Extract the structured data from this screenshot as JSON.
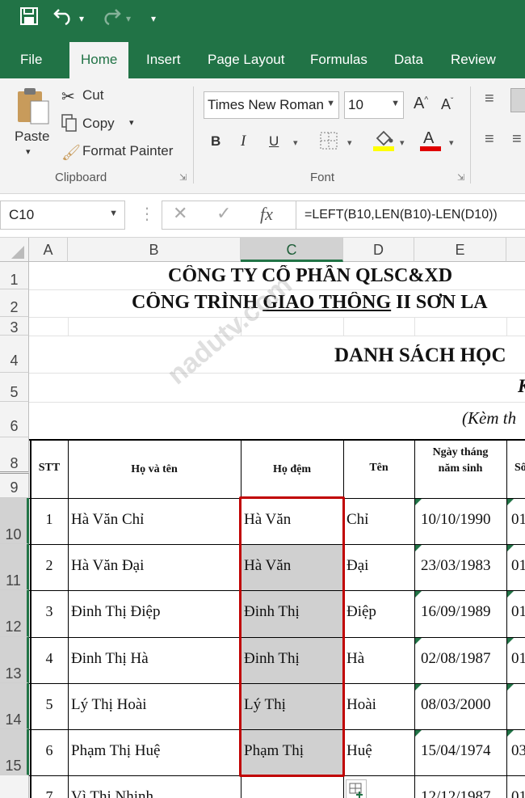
{
  "ribbon_tabs": [
    "File",
    "Home",
    "Insert",
    "Page Layout",
    "Formulas",
    "Data",
    "Review"
  ],
  "clipboard": {
    "paste": "Paste",
    "cut": "Cut",
    "copy": "Copy",
    "format_painter": "Format Painter",
    "group": "Clipboard"
  },
  "font": {
    "name": "Times New Roman",
    "size": "10",
    "group": "Font",
    "bold": "B",
    "italic": "I",
    "underline": "U"
  },
  "name_box": "C10",
  "formula": "=LEFT(B10,LEN(B10)-LEN(D10))",
  "columns": [
    "A",
    "B",
    "C",
    "D",
    "E"
  ],
  "selected_column": "C",
  "rows": [
    "1",
    "2",
    "3",
    "4",
    "5",
    "6",
    "8",
    "9",
    "10",
    "11",
    "12",
    "13",
    "14",
    "15"
  ],
  "title1": "CÔNG TY CỔ PHẦN QLSC&XD",
  "title2": {
    "pre": "CÔNG TRÌNH ",
    "underlined": "GIAO THÔNG",
    "post": " II SƠN LA"
  },
  "title3": "DANH SÁCH HỌC",
  "title5": "K",
  "title6": "(Kèm th",
  "watermark": "nadutv.com",
  "table_headers": {
    "stt": "STT",
    "full_name": "Họ và tên",
    "middle": "Họ đệm",
    "first": "Tên",
    "dob": "Ngày tháng năm sinh",
    "next": "Sô"
  },
  "records": [
    {
      "stt": "1",
      "full_name": "Hà Văn Chỉ",
      "middle": "Hà Văn",
      "first": "Chỉ",
      "dob": "10/10/1990",
      "next": "01"
    },
    {
      "stt": "2",
      "full_name": "Hà Văn Đại",
      "middle": "Hà Văn",
      "first": "Đại",
      "dob": "23/03/1983",
      "next": "01"
    },
    {
      "stt": "3",
      "full_name": "Đinh Thị Điệp",
      "middle": "Đinh Thị",
      "first": "Điệp",
      "dob": "16/09/1989",
      "next": "01"
    },
    {
      "stt": "4",
      "full_name": "Đinh Thị Hà",
      "middle": "Đinh Thị",
      "first": "Hà",
      "dob": "02/08/1987",
      "next": "01"
    },
    {
      "stt": "5",
      "full_name": "Lý Thị Hoài",
      "middle": "Lý Thị",
      "first": "Hoài",
      "dob": "08/03/2000",
      "next": ""
    },
    {
      "stt": "6",
      "full_name": "Phạm Thị Huệ",
      "middle": "Phạm Thị",
      "first": "Huệ",
      "dob": "15/04/1974",
      "next": "03"
    }
  ],
  "partial_row": {
    "stt": "7",
    "full_name": "Vì Thị Nhinh",
    "dob": "12/12/1987",
    "next": "01"
  },
  "colors": {
    "excel_green": "#217346",
    "selection_border": "#c00000",
    "selection_fill": "#d0d0d0"
  }
}
